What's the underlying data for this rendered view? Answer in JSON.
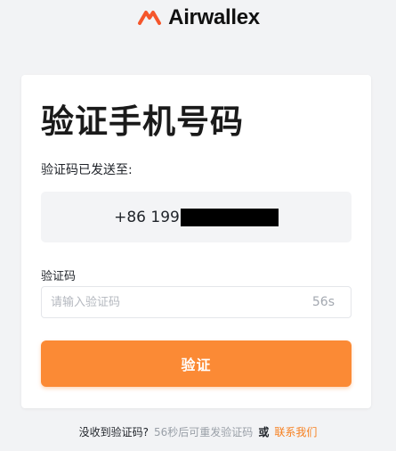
{
  "brand": {
    "name": "Airwallex",
    "accent": "#fb8a35",
    "logo_icon": "airwallex-logo-icon"
  },
  "page": {
    "title": "验证手机号码"
  },
  "phone": {
    "label": "验证码已发送至:",
    "prefix": "+86 199",
    "masked": true
  },
  "code": {
    "label": "验证码",
    "placeholder": "请输入验证码",
    "countdown": "56s"
  },
  "verify_button": {
    "label": "验证"
  },
  "footer": {
    "question": "没收到验证码?",
    "resend_hint": "56秒后可重发验证码",
    "or": "或",
    "contact": "联系我们"
  }
}
